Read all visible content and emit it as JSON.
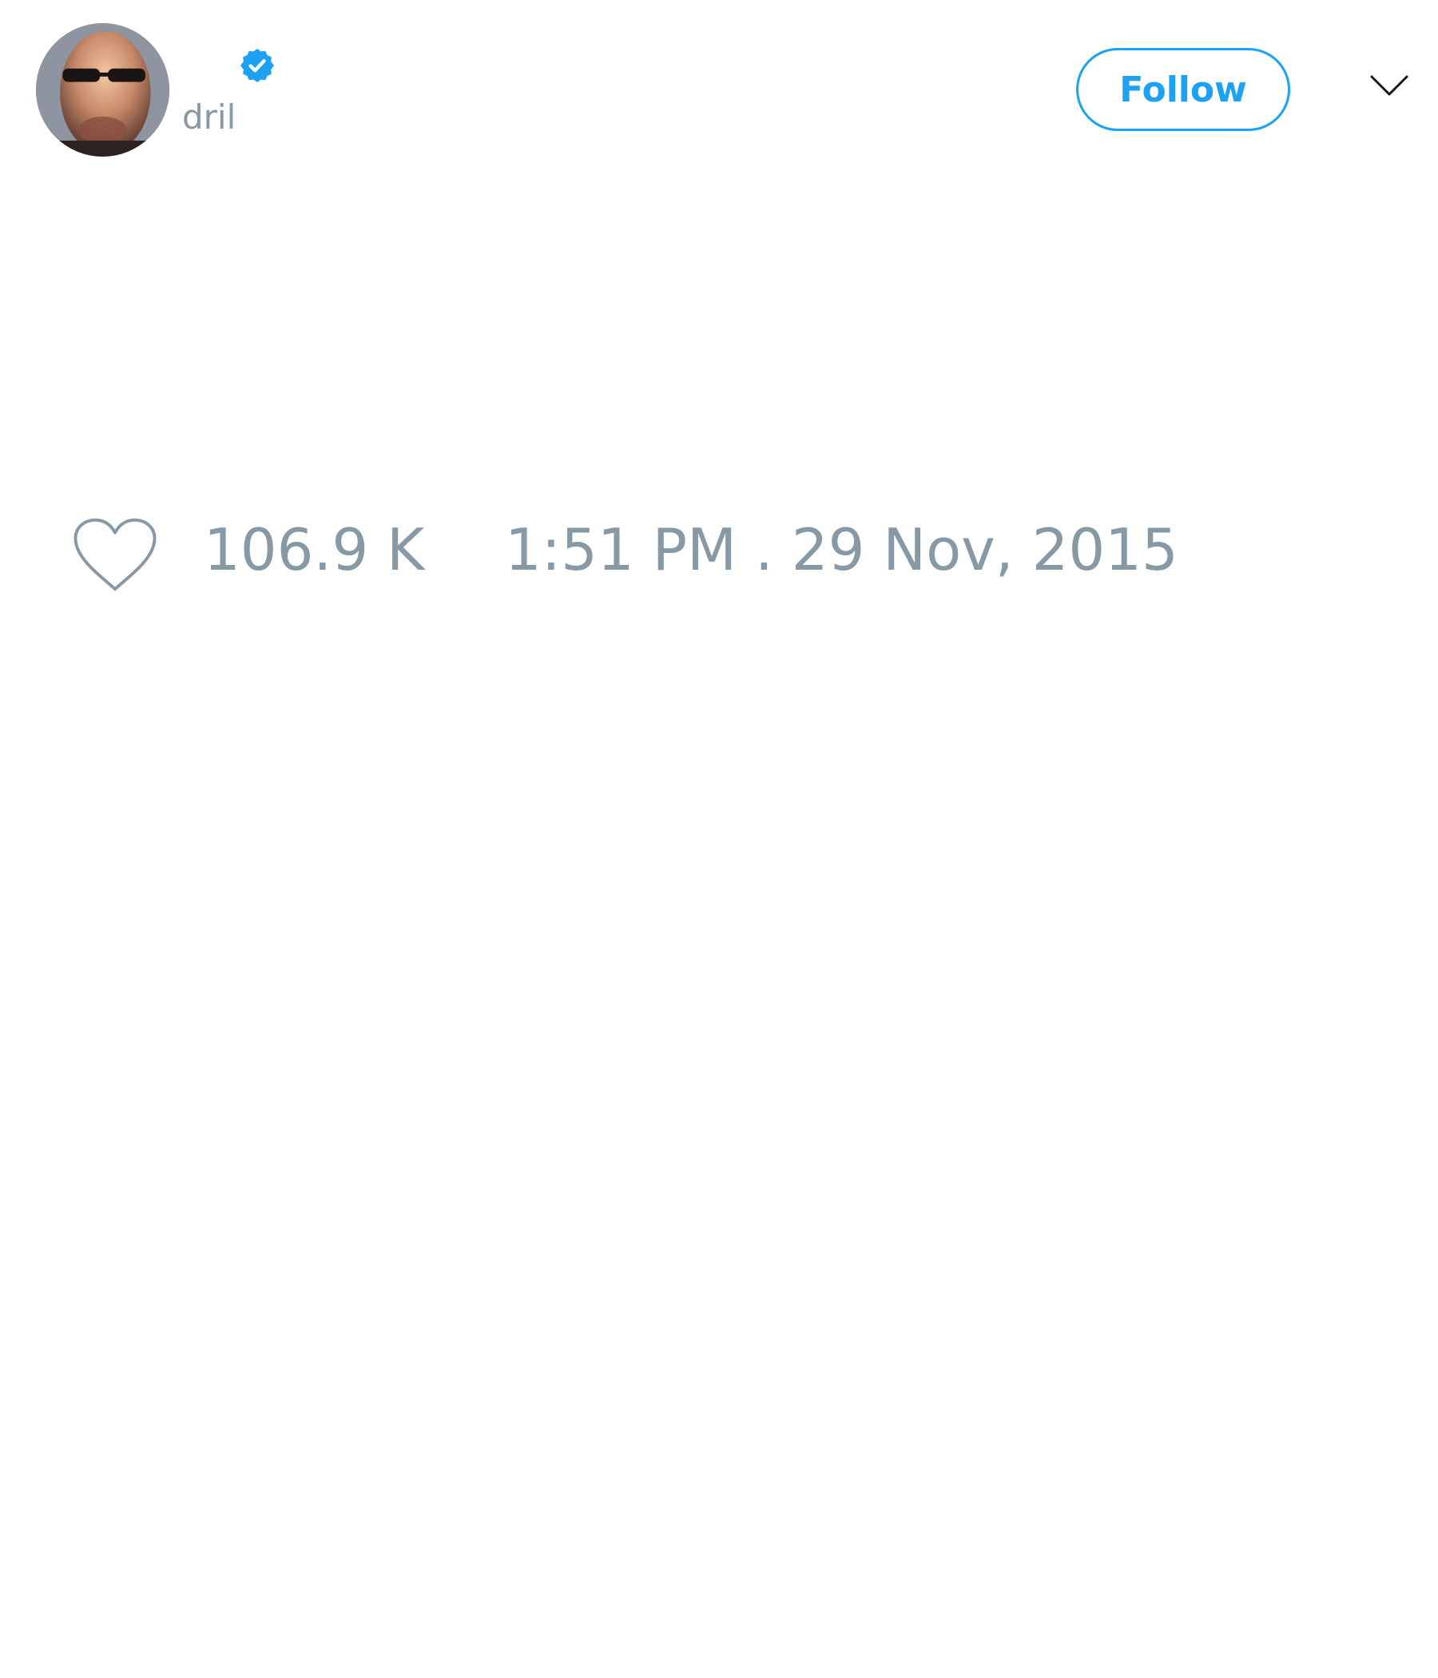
{
  "author": {
    "display_name": "",
    "handle": "dril",
    "verified": true,
    "avatar_icon": "profile-photo"
  },
  "actions": {
    "follow_label": "Follow",
    "menu_icon": "chevron-down-icon"
  },
  "tweet": {
    "text": "",
    "like_icon": "heart-outline-icon",
    "like_count": "106.9 K",
    "timestamp": "1:51 PM . 29 Nov, 2015"
  },
  "colors": {
    "accent": "#1da1f2",
    "muted_text": "#8899a6",
    "background": "#ffffff"
  }
}
